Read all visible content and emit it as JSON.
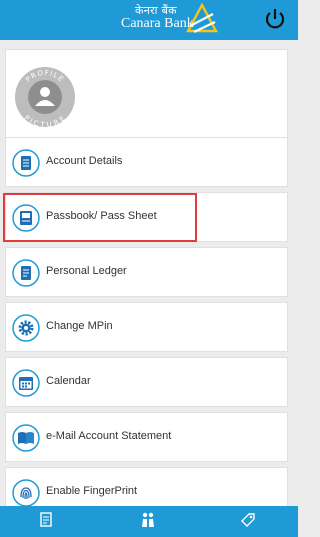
{
  "header": {
    "brand_hindi": "केनरा बैंक",
    "brand_english": "Canara Bank",
    "power_icon": "power-icon"
  },
  "profile": {
    "picture_label_top": "PROFILE",
    "picture_label_bottom": "PICTURE"
  },
  "menu": {
    "items": [
      {
        "label": "Account Details",
        "icon": "document-icon"
      },
      {
        "label": "Passbook/ Pass Sheet",
        "icon": "passbook-icon"
      },
      {
        "label": "Personal Ledger",
        "icon": "ledger-icon"
      },
      {
        "label": "Change MPin",
        "icon": "gear-icon"
      },
      {
        "label": "Calendar",
        "icon": "calendar-icon"
      },
      {
        "label": "e-Mail Account Statement",
        "icon": "book-icon"
      },
      {
        "label": "Enable FingerPrint",
        "icon": "fingerprint-icon"
      }
    ]
  },
  "bottom_nav": {
    "items": [
      {
        "icon": "statement-icon"
      },
      {
        "icon": "people-icon"
      },
      {
        "icon": "tag-icon"
      }
    ]
  },
  "colors": {
    "brand_blue": "#1f9ad6",
    "highlight_red": "#e23b3b",
    "background": "#ececec"
  }
}
